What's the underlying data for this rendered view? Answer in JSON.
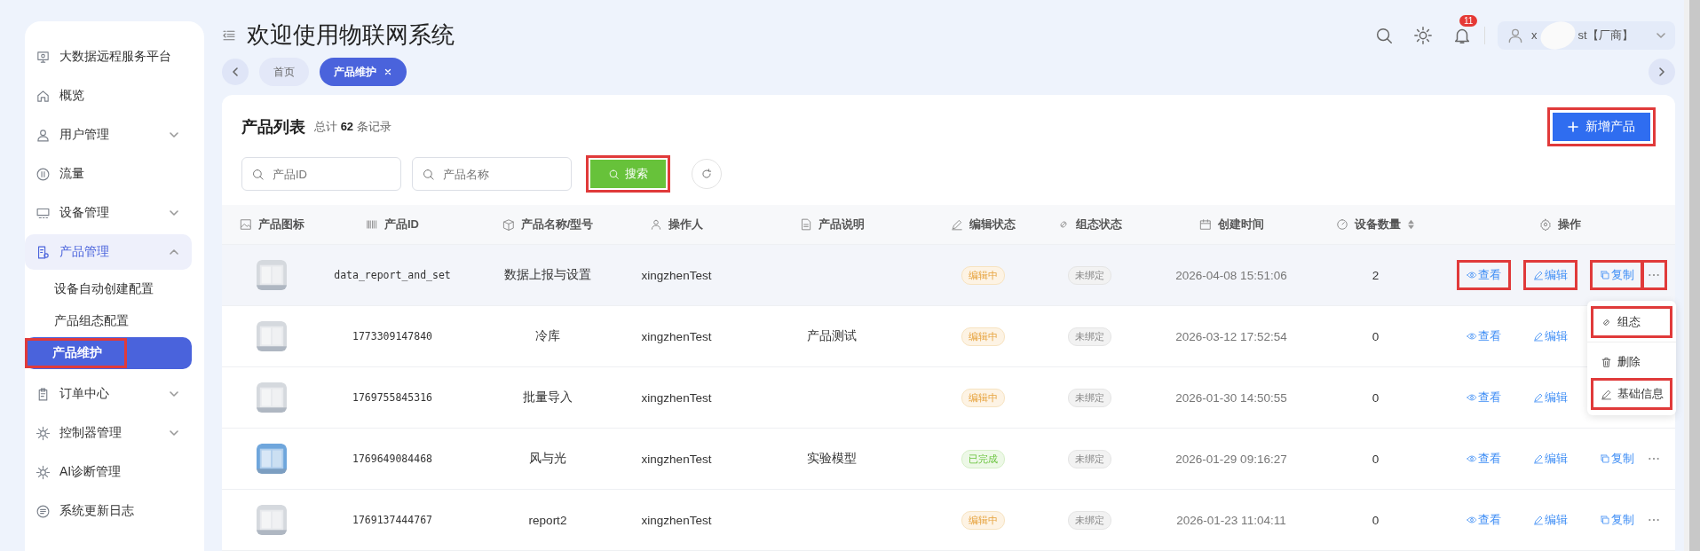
{
  "sidebar": {
    "items": [
      {
        "label": "大数据远程服务平台",
        "selected": false
      },
      {
        "label": "概览",
        "selected": false
      },
      {
        "label": "用户管理",
        "selected": false,
        "expanded": false
      },
      {
        "label": "流量",
        "selected": false
      },
      {
        "label": "设备管理",
        "selected": false,
        "expanded": false
      },
      {
        "label": "产品管理",
        "selected": true,
        "expanded": true,
        "children": [
          {
            "label": "设备自动创建配置",
            "selected": false,
            "highlighted": false
          },
          {
            "label": "产品组态配置",
            "selected": false,
            "highlighted": false
          },
          {
            "label": "产品维护",
            "selected": true,
            "highlighted": true
          }
        ]
      },
      {
        "label": "订单中心",
        "selected": false,
        "expanded": false
      },
      {
        "label": "控制器管理",
        "selected": false,
        "expanded": false
      },
      {
        "label": "AI诊断管理",
        "selected": false
      },
      {
        "label": "系统更新日志",
        "selected": false
      }
    ]
  },
  "header": {
    "title": "欢迎使用物联网系统",
    "notification_count": "11",
    "user_name_start": "x",
    "user_name_end": "st【厂商】"
  },
  "tabs": [
    {
      "label": "首页",
      "selected": false
    },
    {
      "label": "产品维护",
      "selected": true
    }
  ],
  "panel": {
    "title": "产品列表",
    "count_prefix": "总计",
    "count": "62",
    "count_suffix": "条记录",
    "new_button": {
      "label": "新增产品",
      "highlighted": true
    },
    "search_fields": [
      {
        "placeholder": "产品ID"
      },
      {
        "placeholder": "产品名称"
      }
    ],
    "search_button": {
      "label": "搜索",
      "highlighted": true
    }
  },
  "table": {
    "columns": [
      "产品图标",
      "产品ID",
      "产品名称/型号",
      "操作人",
      "产品说明",
      "编辑状态",
      "组态状态",
      "创建时间",
      "设备数量",
      "操作"
    ],
    "rows": [
      {
        "thumbnail": {
          "kind": "picture",
          "color": "#d5d9de"
        },
        "id": "data_report_and_set",
        "name": "数据上报与设置",
        "operator": "xingzhenTest",
        "edit_status": {
          "label": "编辑中",
          "kind": "editing"
        },
        "bind_status": "未绑定",
        "created": "2026-04-08 15:51:06",
        "device_count": "2",
        "hovered": true,
        "actions": [
          {
            "label": "查看",
            "kind": "view",
            "highlighted": true
          },
          {
            "label": "编辑",
            "kind": "edit",
            "highlighted": true
          },
          {
            "label": "复制",
            "kind": "copy",
            "highlighted": true
          },
          {
            "kind": "more",
            "highlighted": true
          }
        ]
      },
      {
        "thumbnail": {
          "kind": "picture",
          "color": "#d5d9de"
        },
        "id": "1773309147840",
        "name": "冷库",
        "operator": "xingzhenTest",
        "description": "产品测试",
        "edit_status": {
          "label": "编辑中",
          "kind": "editing"
        },
        "bind_status": "未绑定",
        "created": "2026-03-12 17:52:54",
        "device_count": "0",
        "hovered": false,
        "actions": [
          {
            "label": "查看",
            "kind": "view",
            "highlighted": false
          },
          {
            "label": "编辑",
            "kind": "edit",
            "highlighted": false
          }
        ]
      },
      {
        "thumbnail": {
          "kind": "picture",
          "color": "#d5d9de"
        },
        "id": "1769755845316",
        "name": "批量导入",
        "operator": "xingzhenTest",
        "edit_status": {
          "label": "编辑中",
          "kind": "editing"
        },
        "bind_status": "未绑定",
        "created": "2026-01-30 14:50:55",
        "device_count": "0",
        "hovered": false,
        "actions": [
          {
            "label": "查看",
            "kind": "view",
            "highlighted": false
          },
          {
            "label": "编辑",
            "kind": "edit",
            "highlighted": false
          }
        ]
      },
      {
        "thumbnail": {
          "kind": "picture",
          "color": "#6fa6dc"
        },
        "id": "1769649084468",
        "name": "风与光",
        "operator": "xingzhenTest",
        "description": "实验模型",
        "edit_status": {
          "label": "已完成",
          "kind": "done"
        },
        "bind_status": "未绑定",
        "created": "2026-01-29 09:16:27",
        "device_count": "0",
        "hovered": false,
        "actions": [
          {
            "label": "查看",
            "kind": "view",
            "highlighted": false
          },
          {
            "label": "编辑",
            "kind": "edit",
            "highlighted": false
          },
          {
            "label": "复制",
            "kind": "copy",
            "highlighted": false
          },
          {
            "kind": "more",
            "highlighted": false
          }
        ]
      },
      {
        "thumbnail": {
          "kind": "picture",
          "color": "#d5d9de"
        },
        "id": "1769137444767",
        "name": "report2",
        "operator": "xingzhenTest",
        "edit_status": {
          "label": "编辑中",
          "kind": "editing"
        },
        "bind_status": "未绑定",
        "created": "2026-01-23 11:04:11",
        "device_count": "0",
        "hovered": false,
        "actions": [
          {
            "label": "查看",
            "kind": "view",
            "highlighted": false
          },
          {
            "label": "编辑",
            "kind": "edit",
            "highlighted": false
          },
          {
            "label": "复制",
            "kind": "copy",
            "highlighted": false
          },
          {
            "kind": "more",
            "highlighted": false
          }
        ]
      }
    ]
  },
  "dropdown_menu": {
    "items": [
      {
        "label": "组态",
        "kind": "link",
        "highlighted": true
      },
      {
        "label": "删除",
        "kind": "trash",
        "highlighted": false
      },
      {
        "label": "基础信息",
        "kind": "edit",
        "highlighted": true
      }
    ]
  }
}
